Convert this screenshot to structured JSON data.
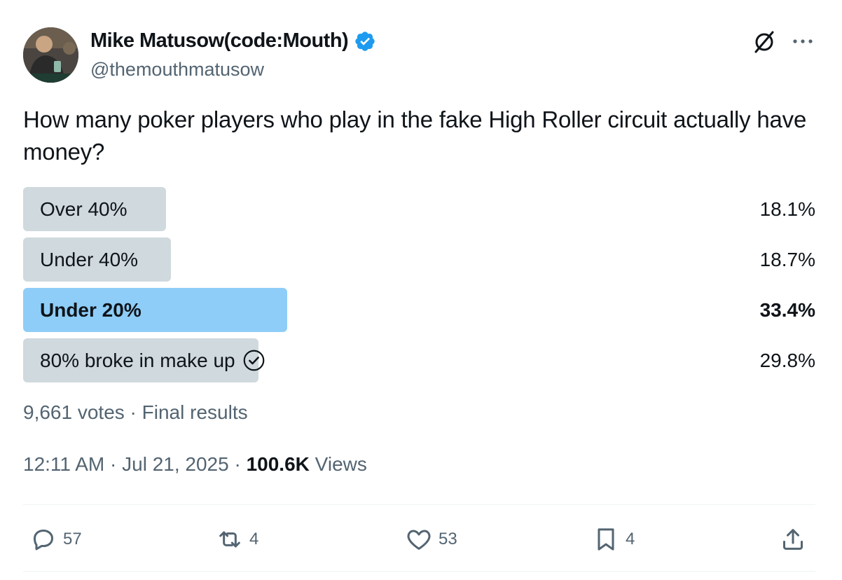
{
  "author": {
    "name": "Mike Matusow(code:Mouth)",
    "handle": "@themouthmatusow"
  },
  "tweet": {
    "text": "How many poker players who play in the fake High Roller circuit actually have money?"
  },
  "poll": {
    "options": [
      {
        "label": "Over 40%",
        "percent": "18.1%",
        "bar_fraction": 0.181,
        "winner": false,
        "voted": false
      },
      {
        "label": "Under 40%",
        "percent": "18.7%",
        "bar_fraction": 0.187,
        "winner": false,
        "voted": false
      },
      {
        "label": "Under 20%",
        "percent": "33.4%",
        "bar_fraction": 0.334,
        "winner": true,
        "voted": false
      },
      {
        "label": "80% broke in make up",
        "percent": "29.8%",
        "bar_fraction": 0.298,
        "winner": false,
        "voted": true
      }
    ],
    "votes_text": "9,661 votes · Final results"
  },
  "meta": {
    "time": "12:11 AM",
    "date": "Jul 21, 2025",
    "views_count": "100.6K",
    "views_label": "Views"
  },
  "actions": {
    "replies": "57",
    "reposts": "4",
    "likes": "53",
    "bookmarks": "4"
  },
  "colors": {
    "poll_default": "#cfd9de",
    "poll_winner": "#8ecdf8",
    "verified": "#1d9bf0",
    "muted": "#536471"
  },
  "icons": [
    "grok-icon",
    "more-icon",
    "verified-badge-icon",
    "checkmark-circle-icon",
    "reply-icon",
    "repost-icon",
    "like-icon",
    "bookmark-icon",
    "share-icon"
  ]
}
